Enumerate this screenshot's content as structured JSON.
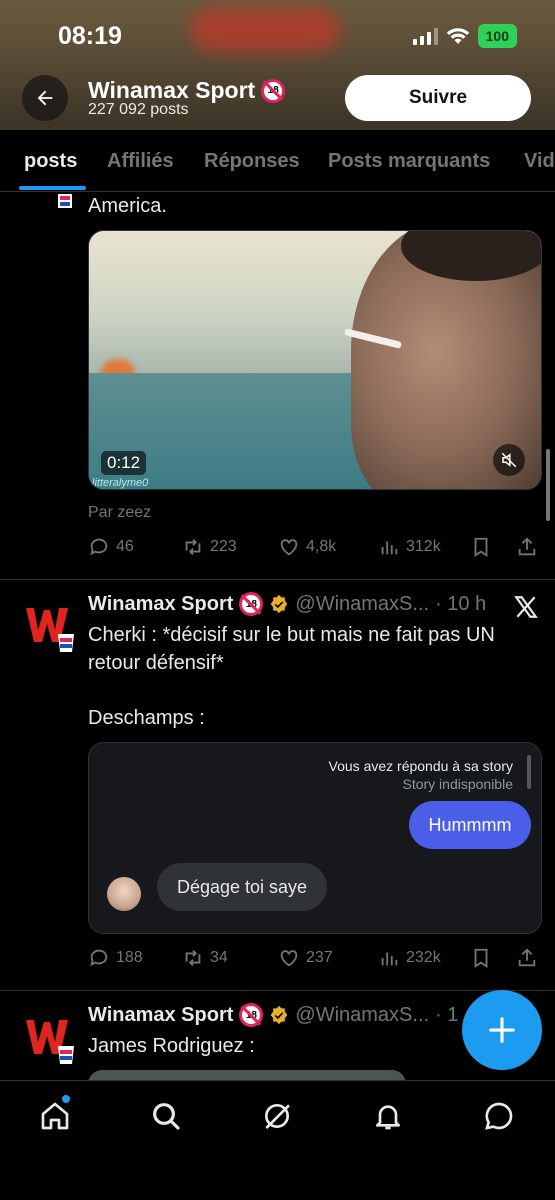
{
  "status_bar": {
    "time": "08:19",
    "battery": "100"
  },
  "profile": {
    "name": "Winamax Sport",
    "posts_count": "227 092 posts",
    "follow_label": "Suivre"
  },
  "tabs": [
    {
      "label": "posts",
      "active": true
    },
    {
      "label": "Affiliés"
    },
    {
      "label": "Réponses"
    },
    {
      "label": "Posts marquants"
    },
    {
      "label": "Vid"
    }
  ],
  "post1": {
    "text_tail": "America.",
    "video_time": "0:12",
    "video_credit": "litteralyme0",
    "attribution": "Par zeez",
    "replies": "46",
    "reposts": "223",
    "likes": "4,8k",
    "views": "312k"
  },
  "post2": {
    "name": "Winamax Sport",
    "handle": "@WinamaxS...",
    "time": "· 10 h",
    "line1": "Cherki : *décisif sur le but mais ne fait pas UN",
    "line2": "retour défensif*",
    "line3": "Deschamps :",
    "story_note": "Vous avez répondu à sa story",
    "story_sub": "Story indisponible",
    "bubble_out": "Hummmm",
    "bubble_in": "Dégage toi saye",
    "replies": "188",
    "reposts": "34",
    "likes": "237",
    "views": "232k"
  },
  "post3": {
    "name": "Winamax Sport",
    "handle": "@WinamaxS...",
    "time": "· 1",
    "text": "James Rodriguez :"
  },
  "icons": {
    "back": "arrow-left-icon",
    "x_logo": "x-logo-icon",
    "compose": "plus-icon",
    "nav": [
      "home-icon",
      "search-icon",
      "grok-icon",
      "bell-icon",
      "messages-icon"
    ]
  },
  "colors": {
    "accent": "#1d9bf0",
    "follow_bg": "#ffffff",
    "bubble_out": "#4a5ee8"
  }
}
